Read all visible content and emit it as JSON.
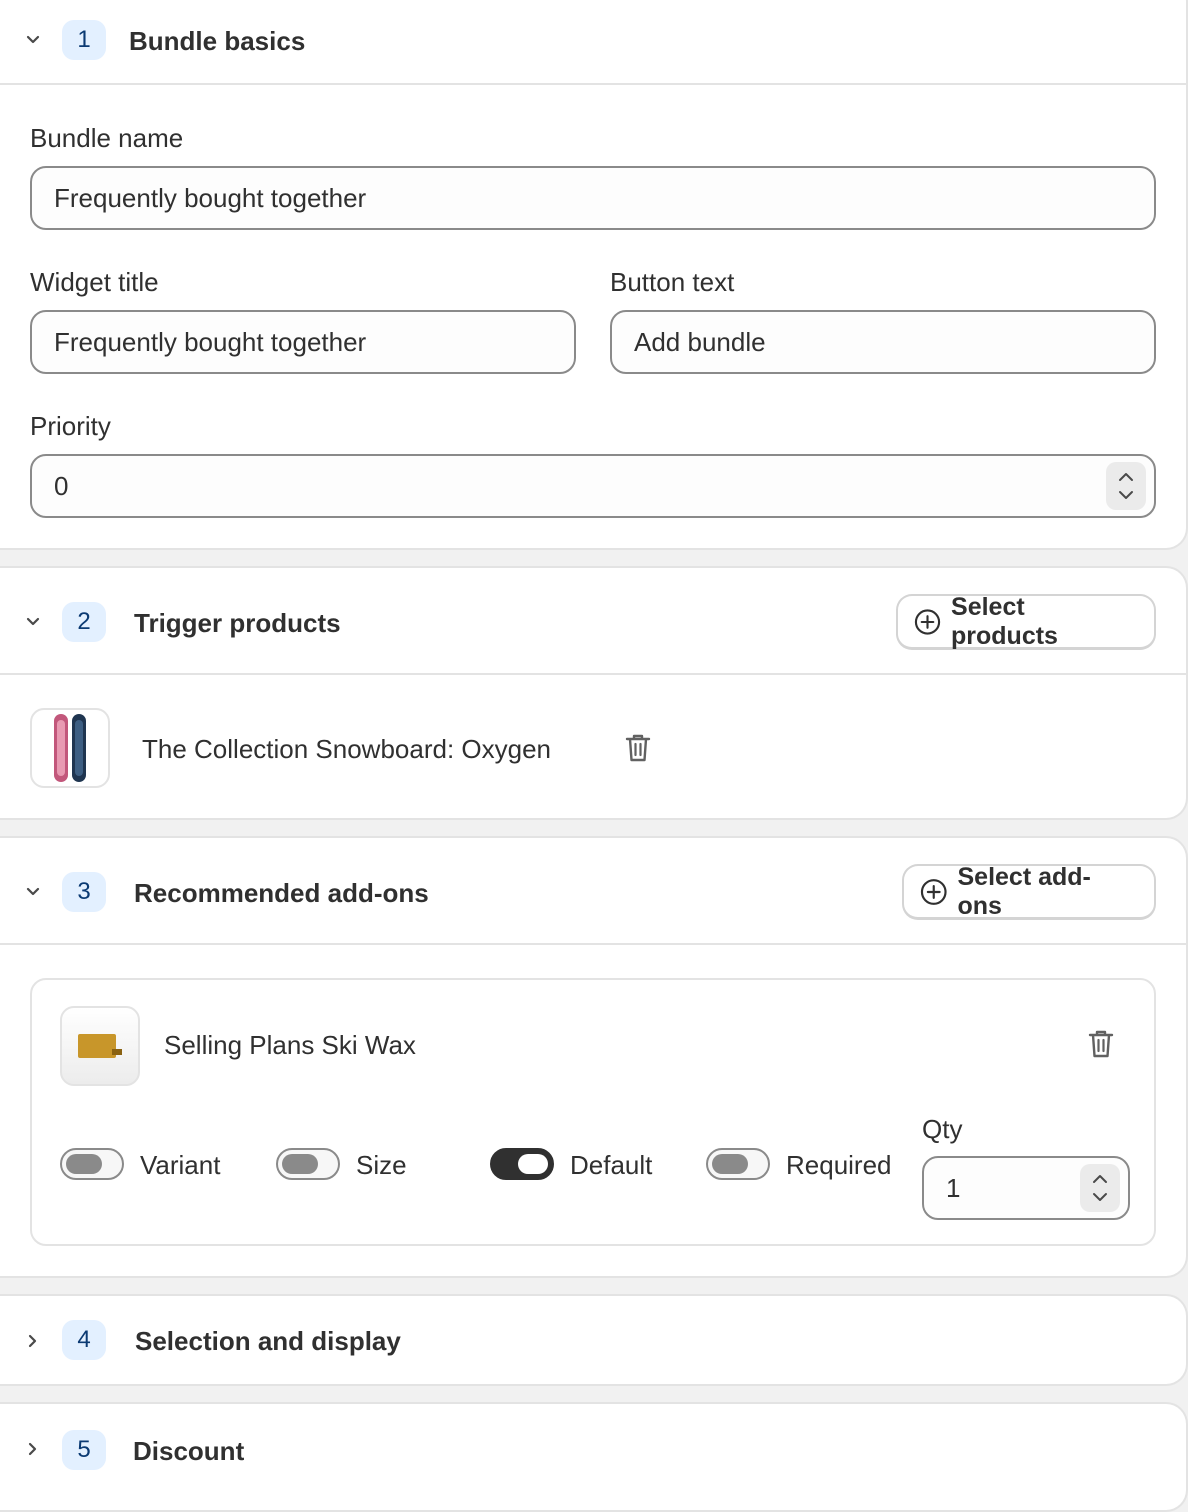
{
  "sections": [
    {
      "step": "1",
      "title": "Bundle basics"
    },
    {
      "step": "2",
      "title": "Trigger products",
      "action_label": "Select products"
    },
    {
      "step": "3",
      "title": "Recommended add-ons",
      "action_label": "Select add-ons"
    },
    {
      "step": "4",
      "title": "Selection and display"
    },
    {
      "step": "5",
      "title": "Discount"
    }
  ],
  "basics": {
    "bundle_name_label": "Bundle name",
    "bundle_name_value": "Frequently bought together",
    "widget_title_label": "Widget title",
    "widget_title_value": "Frequently bought together",
    "button_text_label": "Button text",
    "button_text_value": "Add bundle",
    "priority_label": "Priority",
    "priority_value": "0"
  },
  "trigger": {
    "product_name": "The Collection Snowboard: Oxygen"
  },
  "addon": {
    "product_name": "Selling Plans Ski Wax",
    "toggles": [
      {
        "label": "Variant",
        "on": false
      },
      {
        "label": "Size",
        "on": false
      },
      {
        "label": "Default",
        "on": true
      },
      {
        "label": "Required",
        "on": false
      }
    ],
    "qty_label": "Qty",
    "qty_value": "1"
  },
  "colors": {
    "step_badge_bg": "#e3f0ff",
    "step_badge_text": "#0b3a73",
    "toggle_on": "#303030",
    "toggle_off": "#8a8a8a"
  }
}
